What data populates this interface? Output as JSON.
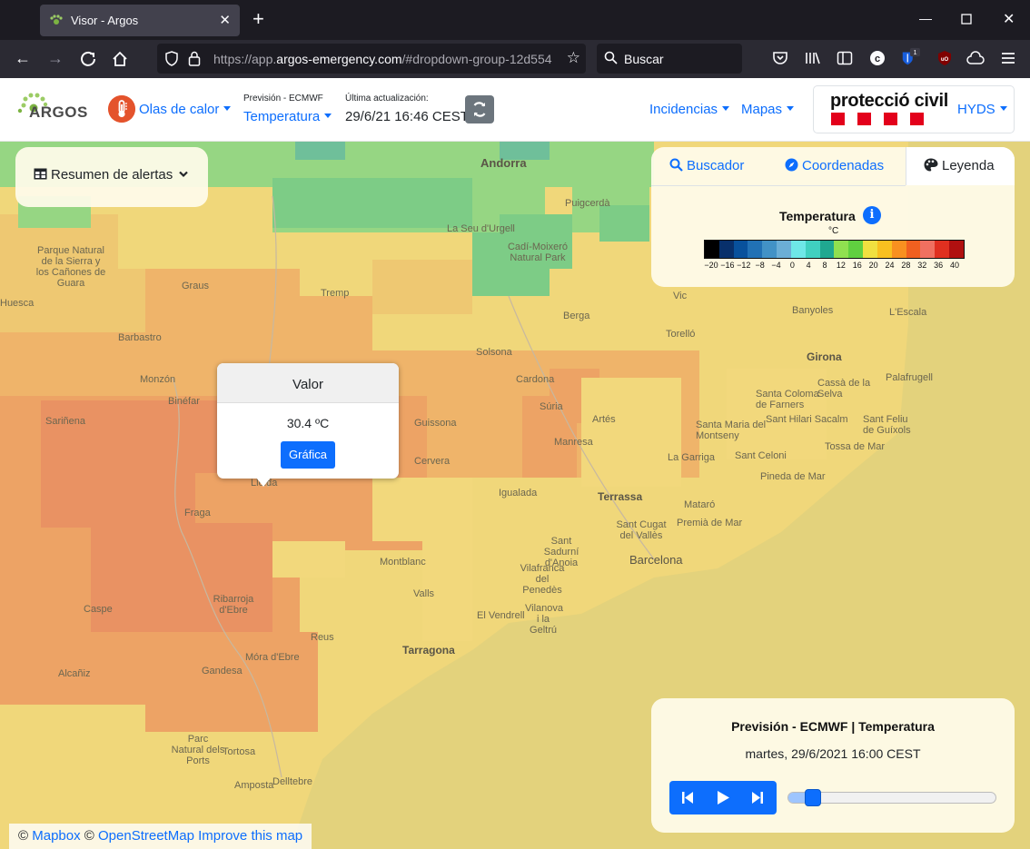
{
  "browser": {
    "tab_title": "Visor - Argos",
    "url_prefix": "https://app.",
    "url_domain": "argos-emergency.com",
    "url_rest": "/#dropdown-group-12d554",
    "search_placeholder": "Buscar",
    "extension_badge": "1"
  },
  "header": {
    "logo_text": "ARGOS",
    "hazard_label": "Olas de calor",
    "model_label": "Previsión - ECMWF",
    "variable_label": "Temperatura",
    "update_label": "Última actualización:",
    "update_time": "29/6/21 16:46 CEST",
    "nav": [
      "Incidencias",
      "Mapas"
    ],
    "org_name": "protecció civil",
    "user_label": "HYDS"
  },
  "alerts": {
    "label": "Resumen de alertas"
  },
  "side_tabs": {
    "tabs": [
      "Buscador",
      "Coordenadas",
      "Leyenda"
    ],
    "active": "Leyenda"
  },
  "legend": {
    "title": "Temperatura",
    "unit": "°C",
    "ticks": [
      "−20",
      "−16",
      "−12",
      "−8",
      "−4",
      "0",
      "4",
      "8",
      "12",
      "16",
      "20",
      "24",
      "28",
      "32",
      "36",
      "40"
    ],
    "colors": [
      "#000000",
      "#08306b",
      "#08519c",
      "#2171b5",
      "#4292c6",
      "#6baed6",
      "#6ee7e7",
      "#40d0c0",
      "#20a890",
      "#90e050",
      "#60d040",
      "#f0e040",
      "#f8c020",
      "#f89020",
      "#f06020",
      "#f07060",
      "#e03020",
      "#b01010"
    ]
  },
  "popup": {
    "title": "Valor",
    "value": "30.4 ºC",
    "button": "Gráfica"
  },
  "player": {
    "title": "Previsión - ECMWF | Temperatura",
    "date": "martes, 29/6/2021 16:00 CEST",
    "progress": 0.08
  },
  "map_labels": {
    "cities": [
      "Andorra",
      "Girona",
      "Terrassa",
      "Barcelona",
      "Tarragona",
      "Mataró"
    ],
    "towns": [
      "Puigcerdà",
      "La Seu d'Urgell",
      "Cadí-Moixeró Natural Park",
      "Parque Natural de la Sierra y los Cañones de Guara",
      "Graus",
      "Tremp",
      "Barbastro",
      "Monzón",
      "Binéfar",
      "Sariñena",
      "Fraga",
      "Lleida",
      "Guissona",
      "Cervera",
      "Solsona",
      "Cardona",
      "Berga",
      "Manresa",
      "Artés",
      "Súria",
      "Igualada",
      "Montblanc",
      "Valls",
      "Vic",
      "Torelló",
      "Banyoles",
      "L'Escala",
      "Palafrugell",
      "Cassà de la Selva",
      "Santa Coloma de Farners",
      "Sant Feliu de Guíxols",
      "Tossa de Mar",
      "Sant Hilari Sacalm",
      "Santa Maria del Montseny",
      "Sant Celoni",
      "La Garriga",
      "Pineda de Mar",
      "Premià de Mar",
      "Sant Cugat del Vallès",
      "Sant Sadurní d'Anoia",
      "Vilafranca del Penedès",
      "El Vendrell",
      "Vilanova i la Geltrú",
      "Reus",
      "Móra d'Ebre",
      "Gandesa",
      "Ribarroja d'Ebre",
      "Caspe",
      "Alcañiz",
      "Tortosa",
      "Amposta",
      "Delltebre",
      "Parc Natural dels Ports",
      "Huesca"
    ]
  },
  "attribution": {
    "mapbox": "Mapbox",
    "osm": "OpenStreetMap",
    "improve": "Improve this map"
  }
}
